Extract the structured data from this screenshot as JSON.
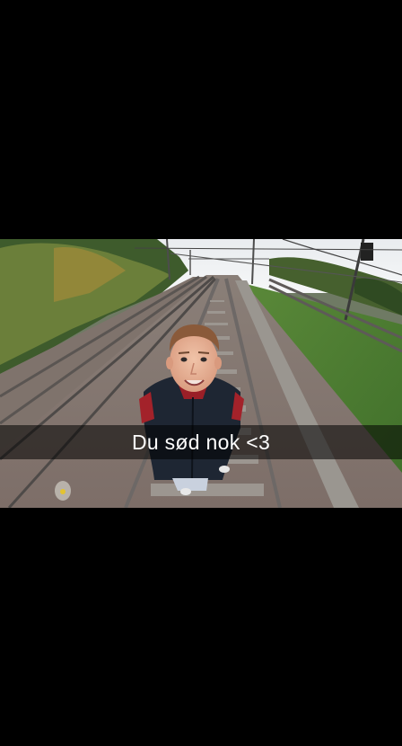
{
  "caption": {
    "text": "Du sød nok <3"
  },
  "colors": {
    "background": "#000000",
    "caption_bar": "rgba(0,0,0,0.55)",
    "caption_text": "#ffffff"
  }
}
